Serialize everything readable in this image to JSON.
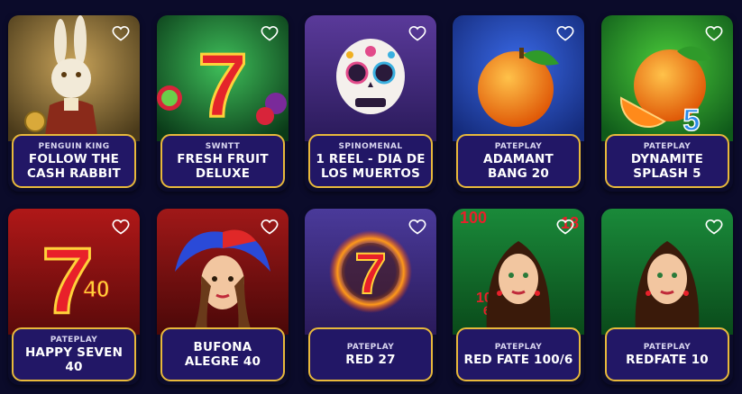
{
  "games": [
    {
      "provider": "PENGUIN KING",
      "title": "FOLLOW THE CASH RABBIT",
      "theme": "rabbit-icon",
      "bg": "#6b5a2a"
    },
    {
      "provider": "SWNTT",
      "title": "FRESH FRUIT DELUXE",
      "theme": "seven-fruit-icon",
      "bg": "#0f6b2f"
    },
    {
      "provider": "SPINOMENAL",
      "title": "1 REEL - DIA DE LOS MUERTOS",
      "theme": "skull-icon",
      "bg": "#3b2a6e"
    },
    {
      "provider": "PATEPLAY",
      "title": "ADAMANT BANG 20",
      "theme": "orange-icon",
      "bg": "#1f3fa8"
    },
    {
      "provider": "PATEPLAY",
      "title": "DYNAMITE SPLASH 5",
      "theme": "orange-five-icon",
      "bg": "#1f8a2e"
    },
    {
      "provider": "PATEPLAY",
      "title": "HAPPY SEVEN 40",
      "theme": "seven-forty-icon",
      "bg": "#8a1414"
    },
    {
      "provider": "",
      "title": "BUFONA ALEGRE 40",
      "theme": "jester-icon",
      "bg": "#7a1010"
    },
    {
      "provider": "PATEPLAY",
      "title": "RED 27",
      "theme": "fire-seven-icon",
      "bg": "#3a2a7e"
    },
    {
      "provider": "PATEPLAY",
      "title": "RED FATE 100/6",
      "theme": "woman-icon",
      "bg": "#136b2a"
    },
    {
      "provider": "PATEPLAY",
      "title": "REDFATE 10",
      "theme": "woman-icon",
      "bg": "#136b2a"
    }
  ],
  "labels": {
    "card_art_small": {
      "fresh_fruit": "7",
      "happy_seven": "7",
      "happy_forty": "40",
      "dynamite_five": "5",
      "red27_seven": "7",
      "redfate_corner_a": "100",
      "redfate_corner_b": "18",
      "redfate_corner_c": "6"
    }
  }
}
